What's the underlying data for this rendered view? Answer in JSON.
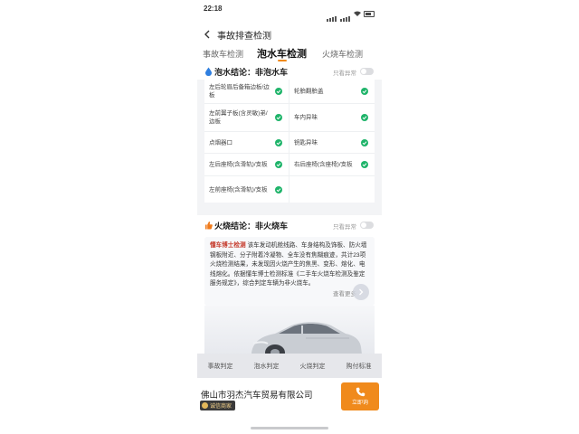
{
  "status_bar": {
    "time": "22:18"
  },
  "header": {
    "title": "事故排查检测"
  },
  "tabs": [
    {
      "label": "事故车检测"
    },
    {
      "label": "泡水车检测",
      "active": true
    },
    {
      "label": "火烧车检测"
    }
  ],
  "water_section": {
    "icon": "water-drop-icon",
    "conclusion": "泡水结论：非泡水车",
    "filter_label": "只看异常",
    "items": [
      {
        "label": "左后轮眉后备箱边板/边板",
        "status": "ok"
      },
      {
        "label": "轮胎翻胎盖",
        "status": "ok"
      },
      {
        "label": "左前翼子板(含灵敏)弟/边板",
        "status": "ok"
      },
      {
        "label": "车内异味",
        "status": "ok"
      },
      {
        "label": "点烟器口",
        "status": "ok"
      },
      {
        "label": "钥匙异味",
        "status": "ok"
      },
      {
        "label": "左后座椅(含滑轨)/支板",
        "status": "ok"
      },
      {
        "label": "右后座椅(含座椅)/支板",
        "status": "ok"
      },
      {
        "label": "左前座椅(含滑轨)/支板",
        "status": "ok"
      }
    ]
  },
  "fire_section": {
    "icon": "thumbs-up-icon",
    "conclusion": "火烧结论：非火烧车",
    "filter_label": "只看异常",
    "report_brand": "懂车博士检测",
    "report_text": "该车发动机舱线路、车身结构及饰板、防火墙钢板附近、分子附着冷凝物、全车没有焦糊痕迹，共计23项火烧检测结果，未发现因火烧产生的焦黑、变形、熔化、电线熔化。依据懂车博士检测标准《二手车火烧车检测及鉴定服务规定》，综合判定车辆为非火烧车。",
    "more_label": "查看更多"
  },
  "bottom_nav": [
    {
      "label": "事故判定"
    },
    {
      "label": "泡水判定"
    },
    {
      "label": "火烧判定"
    },
    {
      "label": "购付标准"
    }
  ],
  "dealer": {
    "name": "佛山市羽杰汽车贸易有限公司",
    "badge": "诚信商家",
    "call_label": "立即询"
  },
  "colors": {
    "accent": "#f08a1c",
    "check": "#1fb46a",
    "brand_red": "#c53a2b",
    "water_icon": "#2f7fe0",
    "fire_icon": "#f07a1a"
  }
}
